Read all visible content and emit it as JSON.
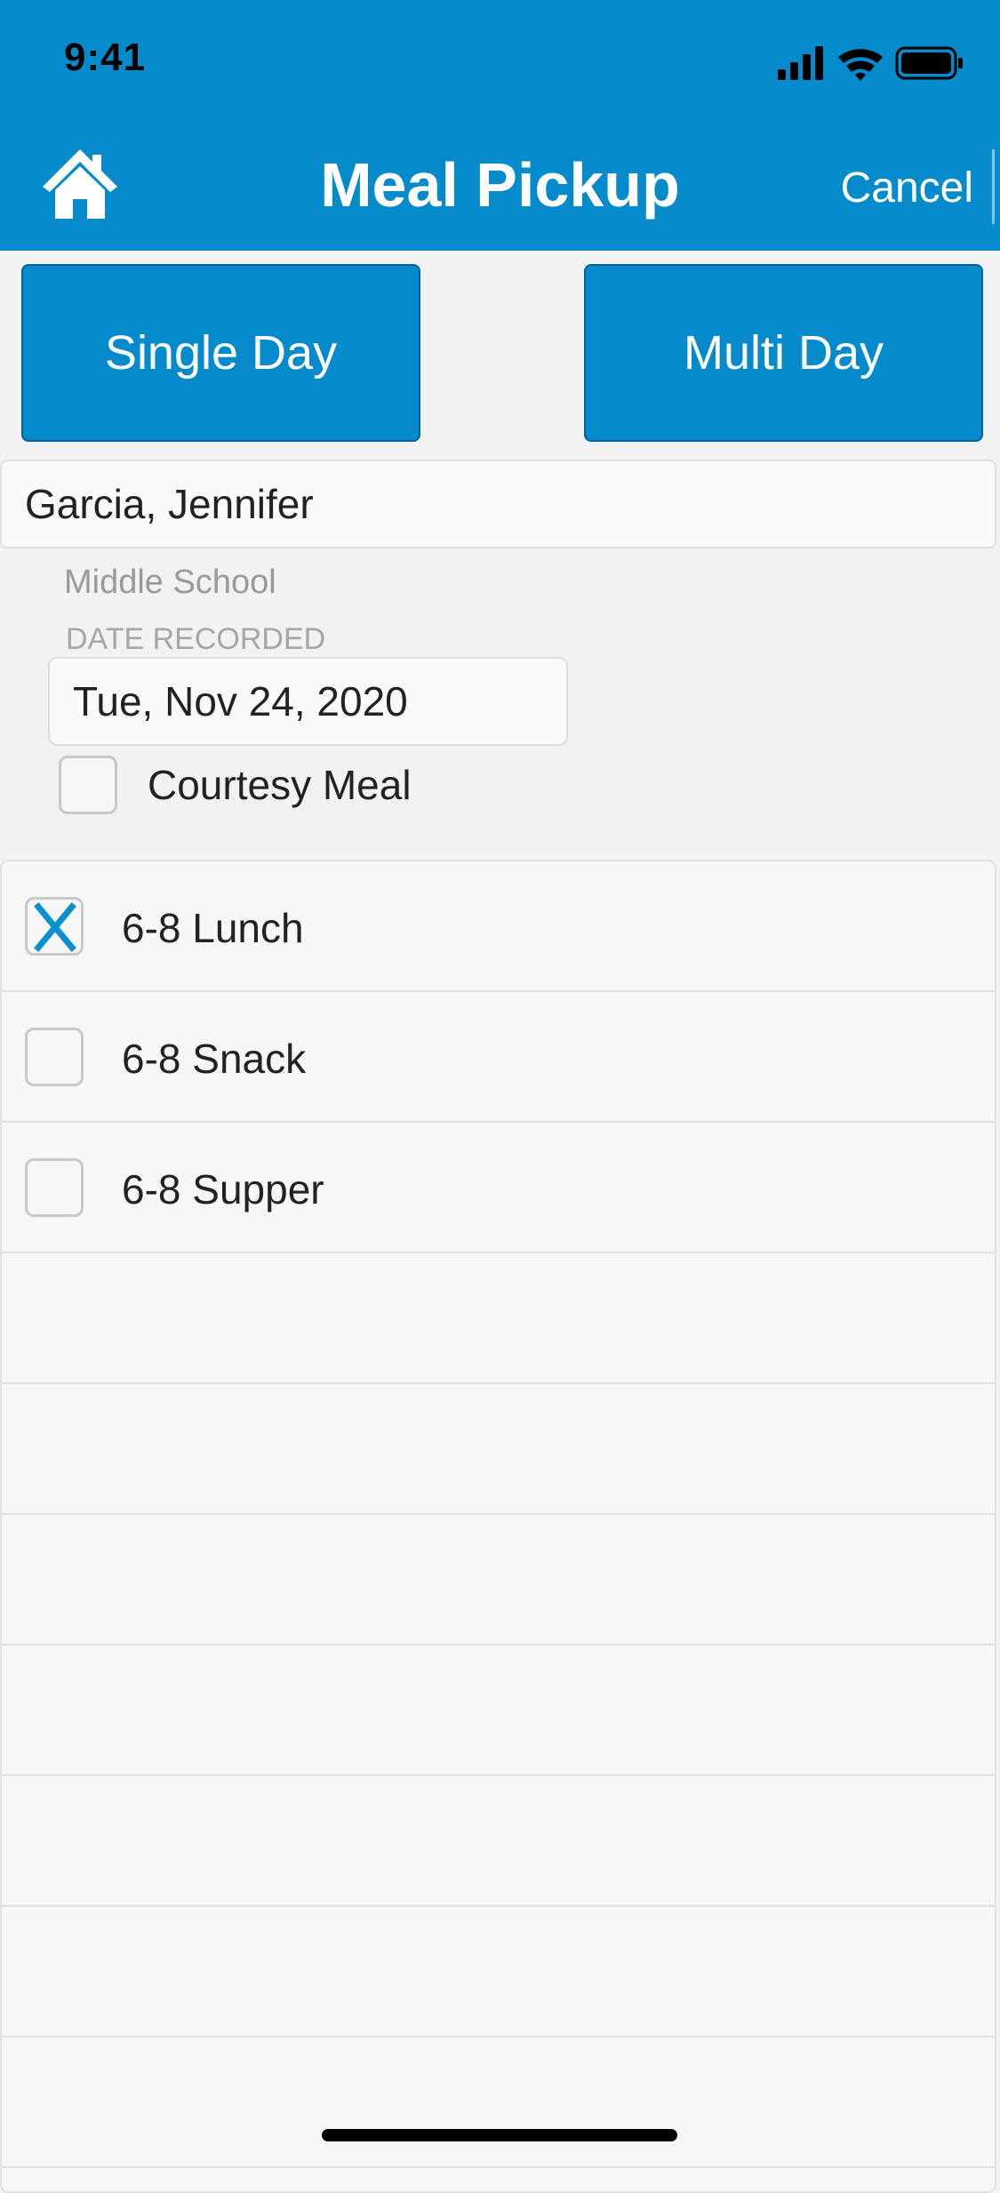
{
  "status_bar": {
    "time": "9:41"
  },
  "header": {
    "title": "Meal Pickup",
    "cancel_label": "Cancel",
    "home_icon": "home-icon",
    "background_color": "#058bcc"
  },
  "mode_buttons": {
    "single_label": "Single Day",
    "multi_label": "Multi Day"
  },
  "student": {
    "name": "Garcia, Jennifer",
    "school": "Middle School"
  },
  "date": {
    "label": "DATE RECORDED",
    "value": "Tue, Nov 24, 2020"
  },
  "courtesy_meal": {
    "label": "Courtesy Meal",
    "checked": false
  },
  "meals": [
    {
      "label": "6-8 Lunch",
      "checked": true
    },
    {
      "label": "6-8 Snack",
      "checked": false
    },
    {
      "label": "6-8 Supper",
      "checked": false
    }
  ],
  "accent_color": "#058bcc"
}
